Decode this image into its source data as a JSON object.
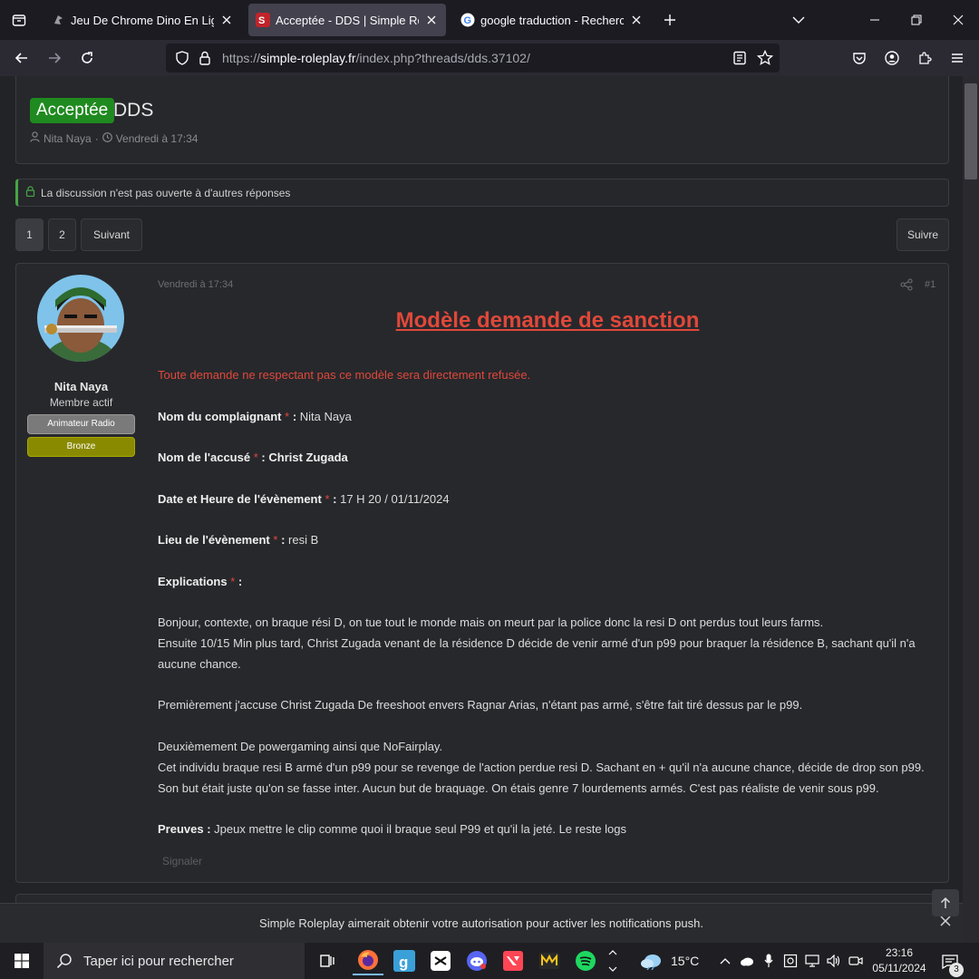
{
  "browser": {
    "tabs": [
      {
        "title": "Jeu De Chrome Dino En Ligne",
        "active": false
      },
      {
        "title": "Acceptée - DDS | Simple Rolepl",
        "active": true
      },
      {
        "title": "google traduction - Recherche",
        "active": false
      }
    ],
    "url": {
      "scheme": "https://",
      "host": "simple-roleplay.fr",
      "path": "/index.php?threads/dds.37102/"
    }
  },
  "thread": {
    "prefix": "Acceptée",
    "title": "DDS",
    "author": "Nita Naya",
    "date": "Vendredi à 17:34",
    "locked_notice": "La discussion n'est pas ouverte à d'autres réponses"
  },
  "pagination": {
    "pages": [
      "1",
      "2"
    ],
    "next_label": "Suivant",
    "follow_label": "Suivre"
  },
  "post": {
    "user": {
      "name": "Nita Naya",
      "title": "Membre actif",
      "banners": [
        "Animateur Radio",
        "Bronze"
      ]
    },
    "date": "Vendredi à 17:34",
    "number": "#1",
    "heading": "Modèle demande de sanction",
    "warning": "Toute demande ne respectant pas ce modèle sera directement refusée.",
    "fields": [
      {
        "label": "Nom du complaignant",
        "value": "Nita Naya"
      },
      {
        "label": "Nom de l'accusé",
        "value": "Christ Zugada"
      },
      {
        "label": "Date et Heure de l'évènement",
        "value": "17 H 20 / 01/11/2024"
      },
      {
        "label": "Lieu de l'évènement",
        "value": "resi B"
      },
      {
        "label": "Explications",
        "value": ""
      }
    ],
    "paragraphs": [
      "Bonjour, contexte, on braque rési D, on tue tout le monde mais on meurt par la police donc la resi D ont perdus tout leurs farms.",
      "Ensuite 10/15 Min plus tard, Christ Zugada venant de la résidence D décide de venir armé d'un p99 pour braquer la résidence B, sachant qu'il n'a aucune chance.",
      "Premièrement j'accuse Christ Zugada De freeshoot envers Ragnar Arias, n'étant pas armé, s'être fait tiré dessus par le p99.",
      "Deuxièmement De powergaming ainsi que NoFairplay.",
      "Cet individu braque resi B armé d'un p99 pour se revenge de l'action perdue resi D. Sachant en + qu'il n'a aucune chance, décide de drop son p99. Son but était juste qu'on se fasse inter. Aucun but de braquage. On étais genre 7 lourdements armés. C'est pas réaliste de venir sous p99."
    ],
    "proof_label": "Preuves :",
    "proof_text": "Jpeux mettre le clip comme quoi il braque seul P99 et qu'il la jeté. Le reste logs",
    "report_label": "Signaler"
  },
  "push_prompt": "Simple Roleplay aimerait obtenir votre autorisation pour activer les notifications push.",
  "taskbar": {
    "search_placeholder": "Taper ici pour rechercher",
    "temperature": "15°C",
    "time": "23:16",
    "date": "05/11/2024",
    "notification_count": "3"
  },
  "colors": {
    "accent_red": "#e0483a",
    "accepted_green": "#1f8a1f",
    "bronze": "#8a8a00"
  }
}
